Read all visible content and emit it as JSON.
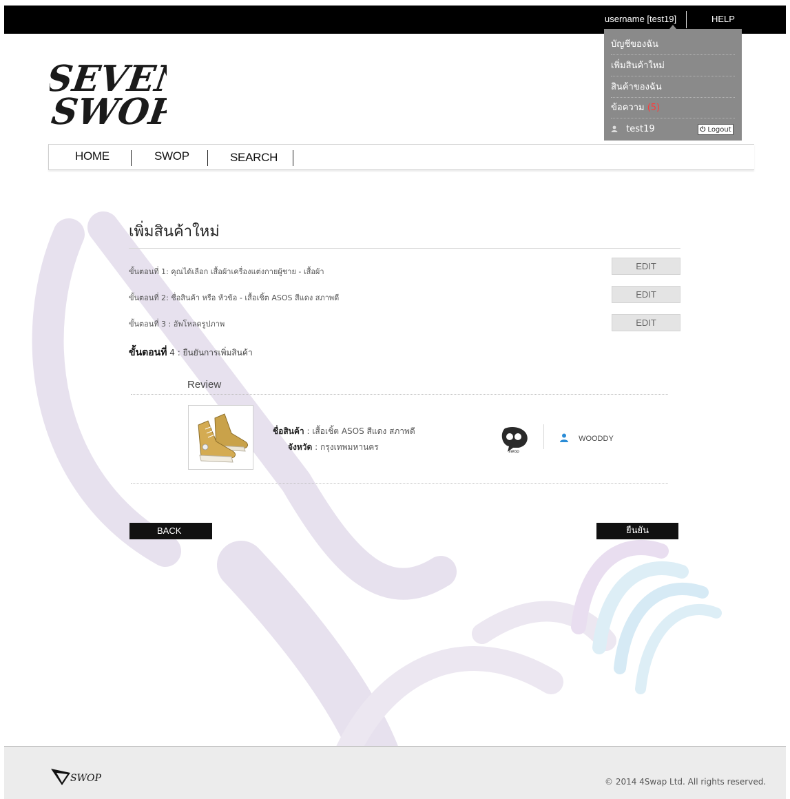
{
  "header": {
    "username": "username [test19]",
    "help": "HELP"
  },
  "user_menu": {
    "items": [
      {
        "label": "บัญชีของฉัน"
      },
      {
        "label": "เพิ่มสินค้าใหม่"
      },
      {
        "label": "สินค้าของฉัน"
      },
      {
        "label": "ข้อความ"
      }
    ],
    "messages_count": "(5)",
    "current_user": "test19",
    "logout": "Logout"
  },
  "logo": {
    "line1": "SEVEN",
    "line2": "SWOP"
  },
  "nav": {
    "items": [
      {
        "label": "HOME"
      },
      {
        "label": "SWOP"
      },
      {
        "label": "SEARCH"
      }
    ]
  },
  "main": {
    "title": "เพิ่มสินค้าใหม่",
    "steps": [
      {
        "prefix": "ขั้นตอนที่ 1",
        "text": ": คุณได้เลือก เสื้อผ้าเครื่องแต่งกายผู้ชาย  -  เสื้อผ้า",
        "edit": "EDIT"
      },
      {
        "prefix": "ขั้นตอนที่ 2",
        "text": ": ชื่อสินค้า หรือ หัวข้อ - เสื้อเชิ้ต ASOS สีแดง สภาพดี",
        "edit": "EDIT"
      },
      {
        "prefix": "ขั้นตอนที่ 3",
        "text": " : อัพโหลดรูปภาพ",
        "edit": "EDIT"
      }
    ],
    "step4": {
      "prefix": "ขั้นตอนที่",
      "text": " 4 : ยืนยันการเพิ่มสินค้า"
    },
    "review": {
      "title": "Review",
      "name_key": "ชื่อสินค้า",
      "name_value": " : เสื้อเชิ้ต ASOS สีแดง สภาพดี",
      "province_key": "จังหวัด",
      "province_value": " : กรุงเทพมหานคร",
      "badge": "swop",
      "owner": "WOODDY"
    },
    "back": "BACK",
    "confirm": "ยืนยัน"
  },
  "footer": {
    "logo_text": "SWOP",
    "copyright": "© 2014 4Swap Ltd. All rights reserved."
  }
}
